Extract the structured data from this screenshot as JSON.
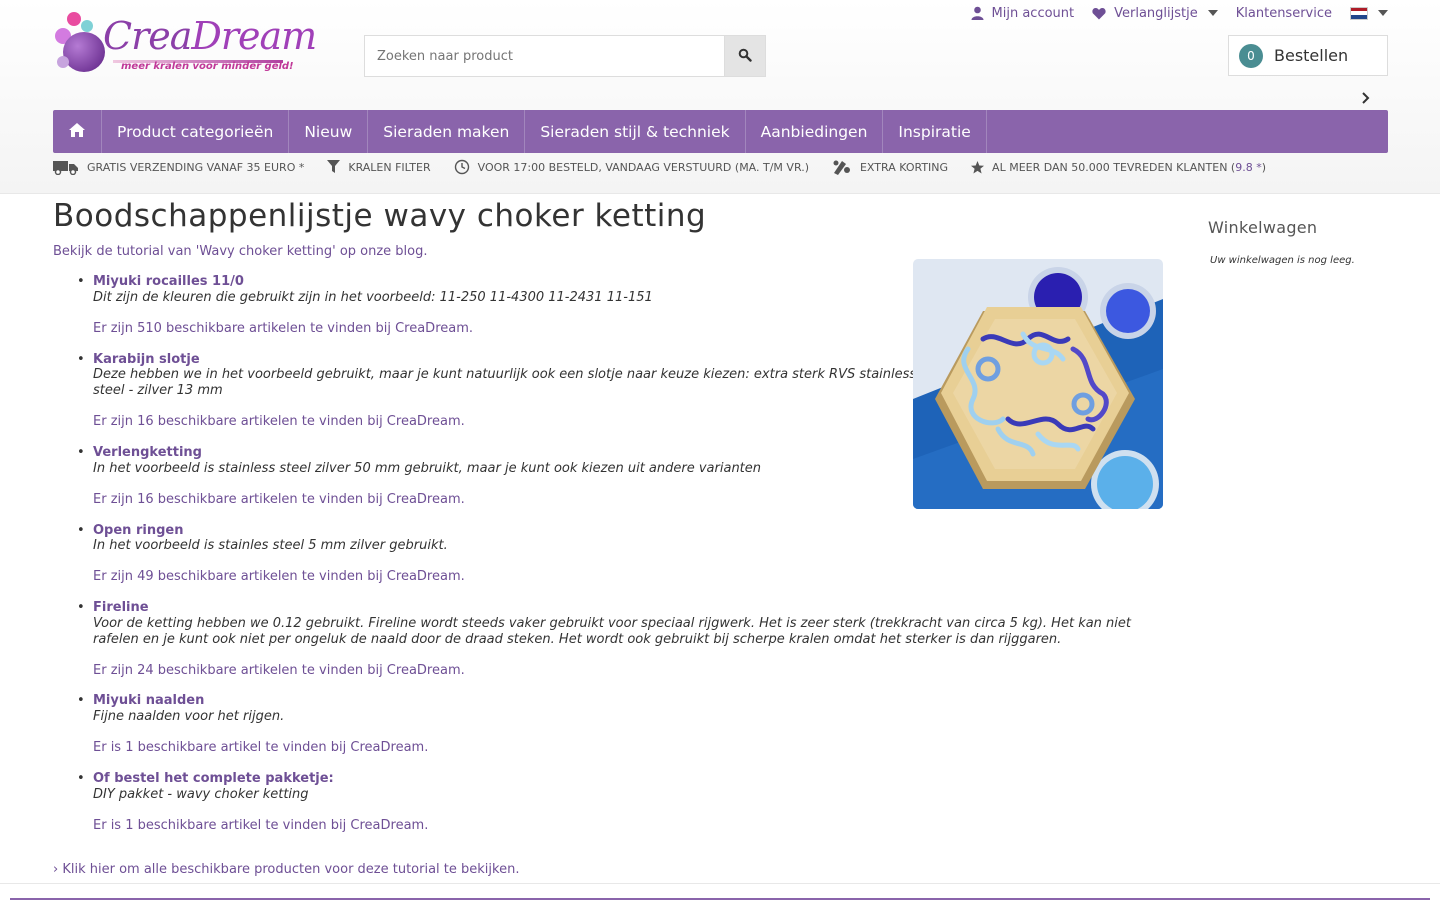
{
  "brand": {
    "name_part1": "Crea",
    "name_part2": "Dream",
    "tagline": "meer kralen voor minder geld!"
  },
  "toplinks": {
    "account": "Mijn account",
    "wishlist": "Verlanglijstje",
    "service": "Klantenservice",
    "language": "NL"
  },
  "search": {
    "placeholder": "Zoeken naar product"
  },
  "cart_button": {
    "count": "0",
    "label": "Bestellen"
  },
  "nav": {
    "items": [
      "Product categorieën",
      "Nieuw",
      "Sieraden maken",
      "Sieraden stijl & techniek",
      "Aanbiedingen",
      "Inspiratie"
    ]
  },
  "usp": {
    "shipping": "Gratis verzending vanaf 35 euro *",
    "filter": "Kralen filter",
    "delivery": "Voor 17:00 besteld, vandaag verstuurd (ma. t/m vr.)",
    "discount": "Extra korting",
    "reviews_prefix": "Al meer dan 50.000 tevreden klanten (",
    "reviews_score": "9.8 *",
    "reviews_suffix": ")"
  },
  "content": {
    "title": "Boodschappenlijstje wavy choker ketting",
    "intro": "Bekijk de tutorial van 'Wavy choker ketting' op onze blog.",
    "items": [
      {
        "name": "Miyuki rocailles 11/0",
        "desc": "Dit zijn de kleuren die gebruikt zijn in het voorbeeld: 11-250 11-4300 11-2431 11-151",
        "avail": "Er zijn 510 beschikbare artikelen te vinden bij CreaDream."
      },
      {
        "name": "Karabijn slotje",
        "desc": "Deze hebben we in het voorbeeld gebruikt, maar je kunt natuurlijk ook een slotje naar keuze kiezen: extra sterk RVS stainless steel - zilver 13 mm",
        "avail": "Er zijn 16 beschikbare artikelen te vinden bij CreaDream."
      },
      {
        "name": "Verlengketting",
        "desc": "In het voorbeeld is stainless steel zilver 50 mm gebruikt, maar je kunt ook kiezen uit andere varianten",
        "avail": "Er zijn 16 beschikbare artikelen te vinden bij CreaDream."
      },
      {
        "name": "Open ringen",
        "desc": "In het voorbeeld is stainles steel 5 mm zilver gebruikt.",
        "avail": "Er zijn 49 beschikbare artikelen te vinden bij CreaDream."
      },
      {
        "name": "Fireline",
        "desc": "Voor de ketting hebben we 0.12 gebruikt. Fireline wordt steeds vaker gebruikt voor speciaal rijgwerk. Het is zeer sterk (trekkracht van circa 5 kg). Het kan niet rafelen en je kunt ook niet per ongeluk de naald door de draad steken. Het wordt ook gebruikt bij scherpe kralen omdat het sterker is dan rijggaren.",
        "avail": "Er zijn 24 beschikbare artikelen te vinden bij CreaDream."
      },
      {
        "name": "Miyuki naalden",
        "desc": "Fijne naalden voor het rijgen.",
        "avail": "Er is 1 beschikbare artikel te vinden bij CreaDream."
      },
      {
        "name": "Of bestel het complete pakketje:",
        "desc": "DIY pakket - wavy choker ketting",
        "avail": "Er is 1 beschikbare artikel te vinden bij CreaDream."
      }
    ],
    "all_link": "› Klik hier om alle beschikbare producten voor deze tutorial te bekijken."
  },
  "sidebar": {
    "cart_title": "Winkelwagen",
    "cart_empty": "Uw winkelwagen is nog leeg."
  },
  "colors": {
    "brand_purple": "#8a64ab",
    "link_purple": "#6e4f95",
    "badge_teal": "#4a8d92"
  },
  "icons": {
    "account": "user-icon",
    "wishlist": "heart-icon",
    "search": "search-icon",
    "home": "home-icon",
    "shipping": "truck-icon",
    "filter": "funnel-icon",
    "delivery": "clock-icon",
    "discount": "discount-icon",
    "reviews": "star-icon"
  }
}
